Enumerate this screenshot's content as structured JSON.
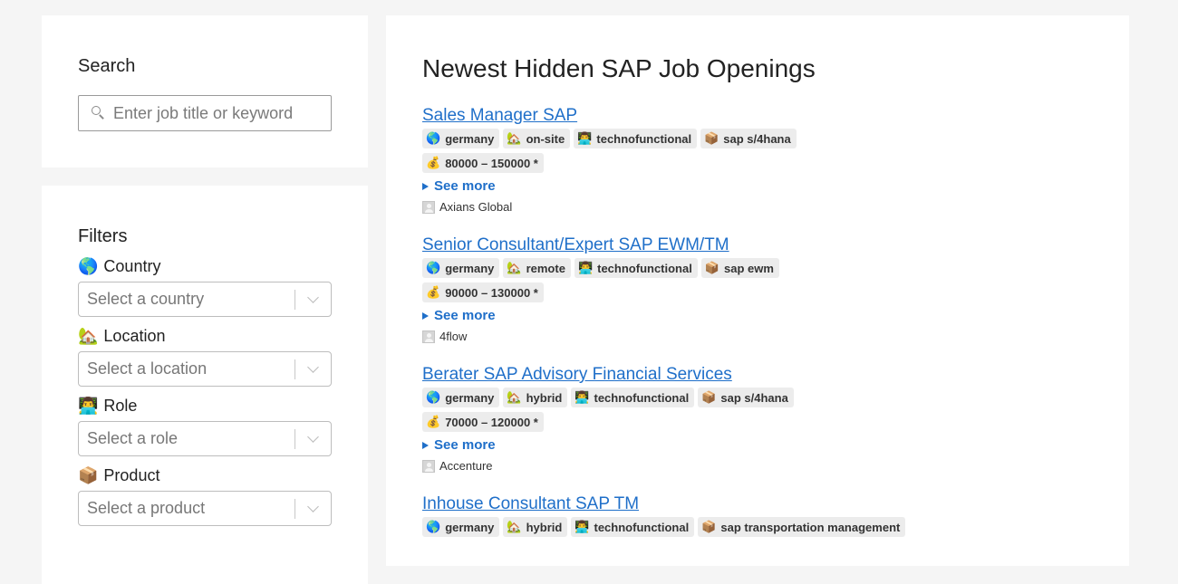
{
  "search": {
    "title": "Search",
    "placeholder": "Enter job title or keyword"
  },
  "filters": {
    "title": "Filters",
    "groups": [
      {
        "emoji": "🌎",
        "label": "Country",
        "placeholder": "Select a country"
      },
      {
        "emoji": "🏡",
        "label": "Location",
        "placeholder": "Select a location"
      },
      {
        "emoji": "👨‍💻",
        "label": "Role",
        "placeholder": "Select a role"
      },
      {
        "emoji": "📦",
        "label": "Product",
        "placeholder": "Select a product"
      }
    ]
  },
  "main": {
    "title": "Newest Hidden SAP Job Openings",
    "see_more_label": "See more",
    "icons": {
      "country": "🌎",
      "location": "🏡",
      "role": "👨‍💻",
      "product": "📦",
      "salary": "💰"
    },
    "jobs": [
      {
        "title": "Sales Manager SAP",
        "country": "germany",
        "location": "on-site",
        "role": "technofunctional",
        "product": "sap s/4hana",
        "salary": "80000 – 150000 *",
        "company": "Axians Global"
      },
      {
        "title": "Senior Consultant/Expert SAP EWM/TM",
        "country": "germany",
        "location": "remote",
        "role": "technofunctional",
        "product": "sap ewm",
        "salary": "90000 – 130000 *",
        "company": "4flow"
      },
      {
        "title": "Berater SAP Advisory Financial Services",
        "country": "germany",
        "location": "hybrid",
        "role": "technofunctional",
        "product": "sap s/4hana",
        "salary": "70000 – 120000 *",
        "company": "Accenture"
      },
      {
        "title": "Inhouse Consultant SAP TM",
        "country": "germany",
        "location": "hybrid",
        "role": "technofunctional",
        "product": "sap transportation management",
        "salary": "",
        "company": ""
      }
    ]
  }
}
